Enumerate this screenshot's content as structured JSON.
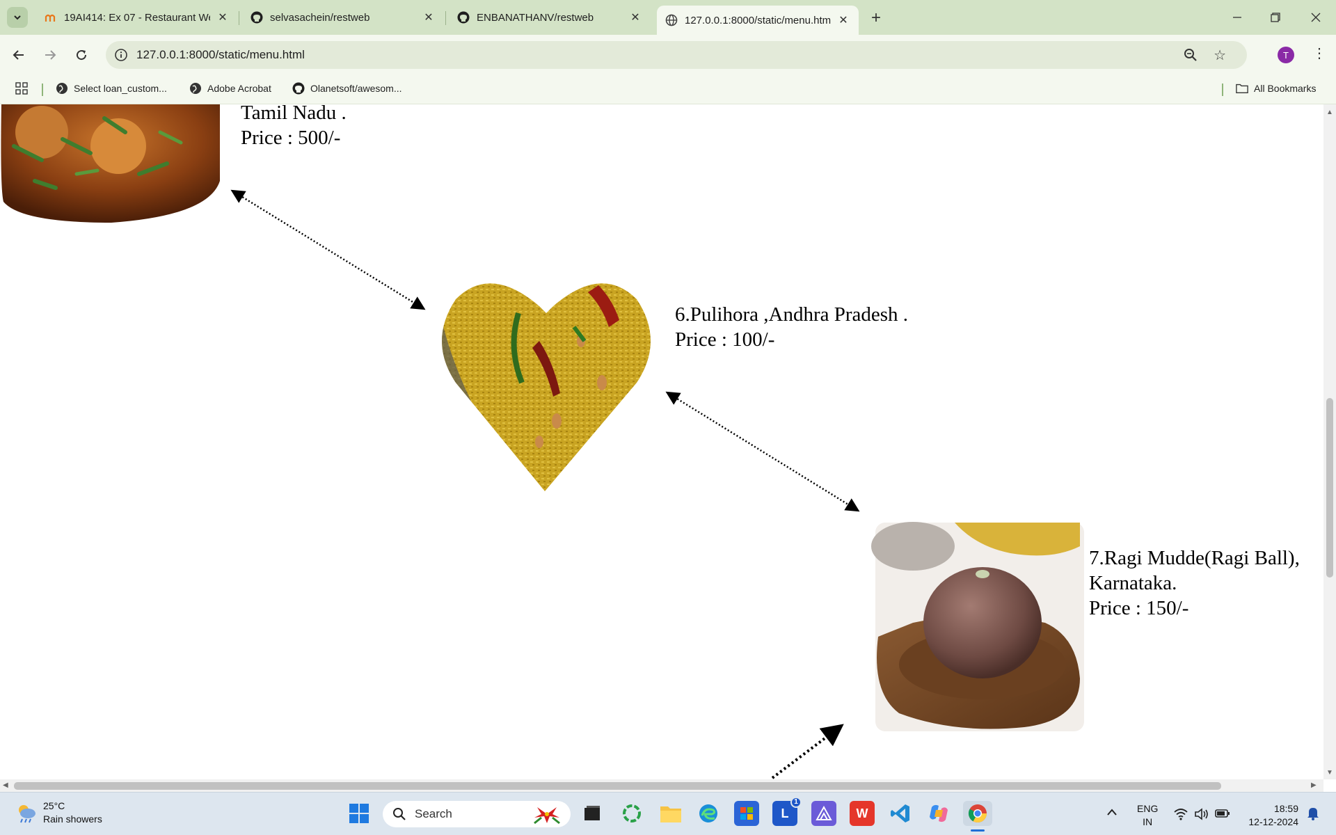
{
  "browser": {
    "tabs": [
      {
        "title": "19AI414: Ex 07 - Restaurant We",
        "active": false
      },
      {
        "title": "selvasachein/restweb",
        "active": false
      },
      {
        "title": "ENBANATHANV/restweb",
        "active": false
      },
      {
        "title": "127.0.0.1:8000/static/menu.htm",
        "active": true
      }
    ],
    "url": "127.0.0.1:8000/static/menu.html",
    "profile_initial": "T",
    "bookmarks": [
      "Select loan_custom...",
      "Adobe Acrobat",
      "Olanetsoft/awesom..."
    ],
    "all_bookmarks_label": "All Bookmarks"
  },
  "menu": {
    "item5": {
      "line1": "Tamil Nadu .",
      "price": "Price : 500/-"
    },
    "item6": {
      "name": "6.Pulihora ,Andhra Pradesh .",
      "price": "Price : 100/-"
    },
    "item7": {
      "name": "7.Ragi Mudde(Ragi Ball),",
      "line2": "Karnataka.",
      "price": "Price : 150/-"
    }
  },
  "taskbar": {
    "weather_temp": "25°C",
    "weather_desc": "Rain showers",
    "search_placeholder": "Search",
    "lang_top": "ENG",
    "lang_bottom": "IN",
    "time": "18:59",
    "date": "12-12-2024",
    "badge_count": "1"
  },
  "colors": {
    "tabstrip": "#d3e3c6",
    "toolbar": "#f4f8ef",
    "taskbar": "#dde6ef"
  }
}
